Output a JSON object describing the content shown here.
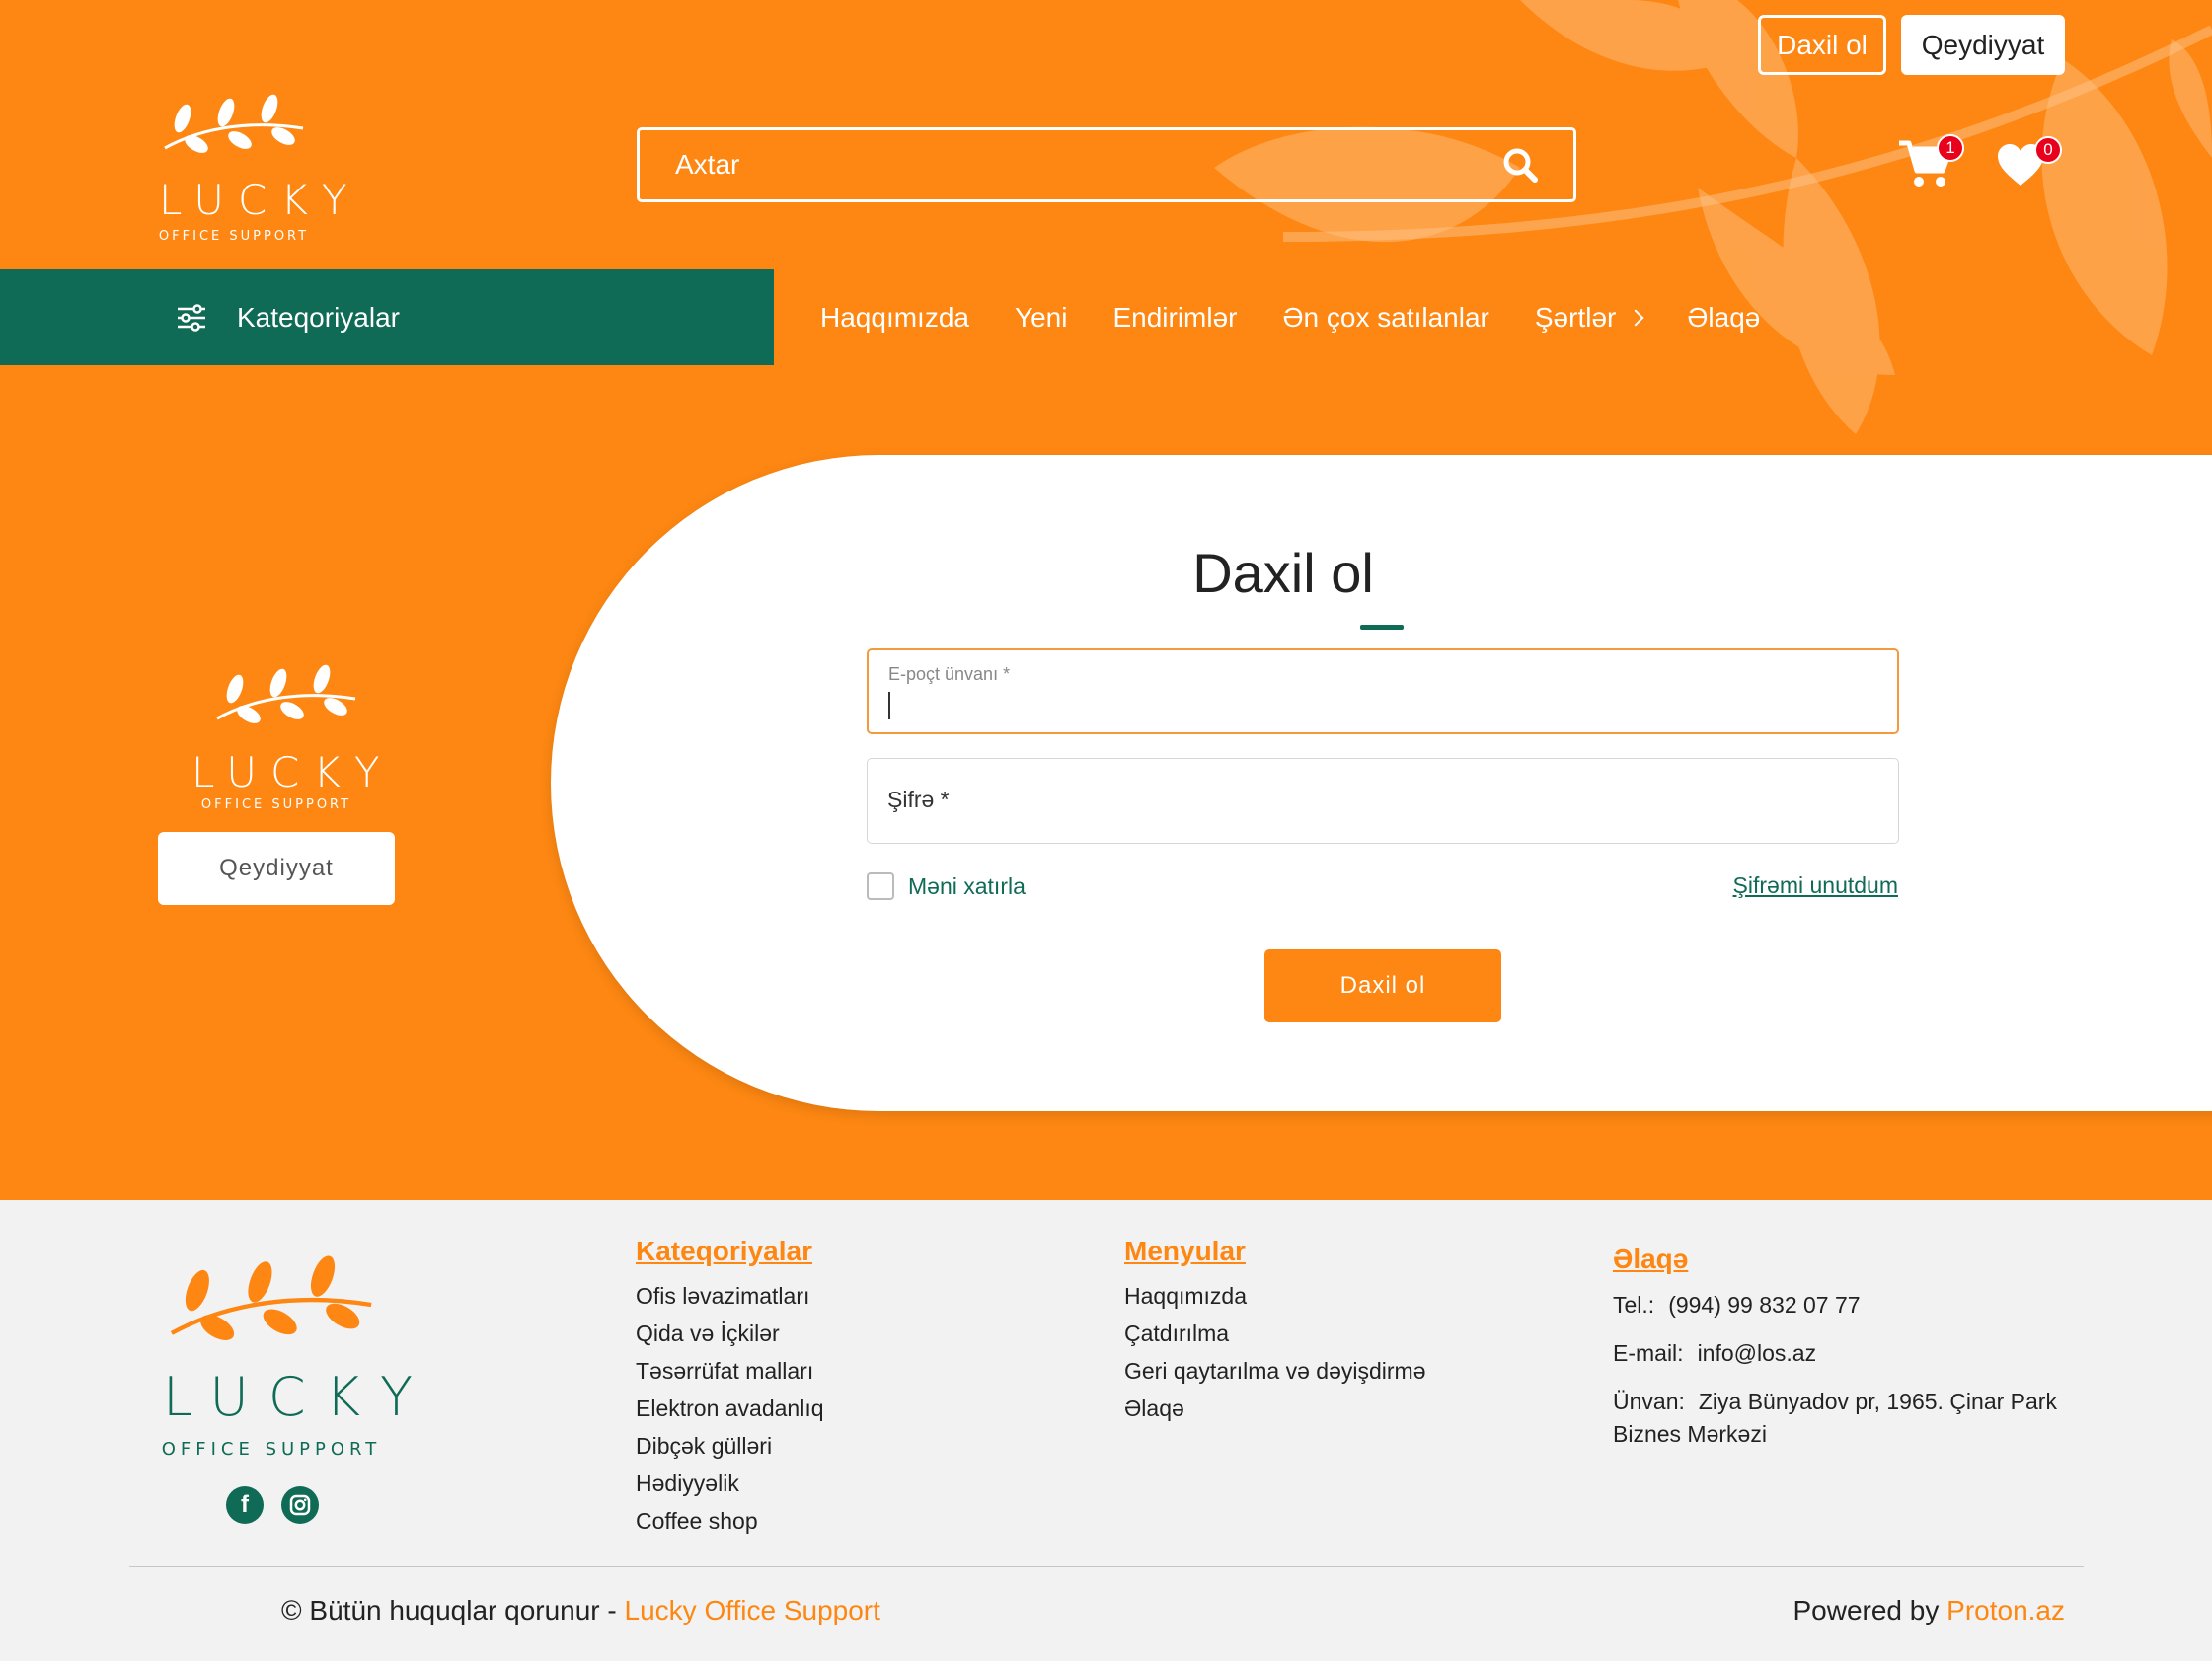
{
  "brand": {
    "logo_word": "LUCKY",
    "logo_sub": "OFFICE SUPPORT",
    "primary_color": "#fd8712",
    "secondary_color": "#106b56"
  },
  "header": {
    "search_placeholder": "Axtar",
    "login_label": "Daxil ol",
    "register_label": "Qeydiyyat",
    "cart_count": "1",
    "favorites_count": "0"
  },
  "nav": {
    "categories_label": "Kateqoriyalar",
    "items": [
      {
        "label": "Haqqımızda"
      },
      {
        "label": "Yeni"
      },
      {
        "label": "Endirimlər"
      },
      {
        "label": "Ən çox satılanlar"
      },
      {
        "label": "Şərtlər"
      },
      {
        "label": "Əlaqə"
      }
    ]
  },
  "side": {
    "register_label": "Qeydiyyat"
  },
  "login": {
    "title": "Daxil ol",
    "email_label": "E-poçt ünvanı *",
    "password_label": "Şifrə *",
    "remember_label": "Məni xatırla",
    "forgot_label": "Şifrəmi unutdum",
    "submit_label": "Daxil ol"
  },
  "footer": {
    "categories": {
      "title": "Kateqoriyalar",
      "items": [
        "Ofis ləvazimatları",
        "Qida və İçkilər",
        "Təsərrüfat malları",
        "Elektron avadanlıq",
        "Dibçək gülləri",
        "Hədiyyəlik",
        "Coffee shop"
      ]
    },
    "menus": {
      "title": "Menyular",
      "items": [
        "Haqqımızda",
        "Çatdırılma",
        "Geri qaytarılma və dəyişdirmə",
        "Əlaqə"
      ]
    },
    "contact": {
      "title": "Əlaqə",
      "phone_key": "Tel.:",
      "phone": "(994) 99 832 07 77",
      "email_key": "E-mail:",
      "email": "info@los.az",
      "address_key": "Ünvan:",
      "address": "Ziya Bünyadov pr, 1965. Çinar Park Biznes Mərkəzi"
    },
    "copyright_prefix": "© Bütün huquqlar qorunur -",
    "copyright_brand": "Lucky Office Support",
    "powered_prefix": "Powered by",
    "powered_brand": "Proton.az"
  }
}
